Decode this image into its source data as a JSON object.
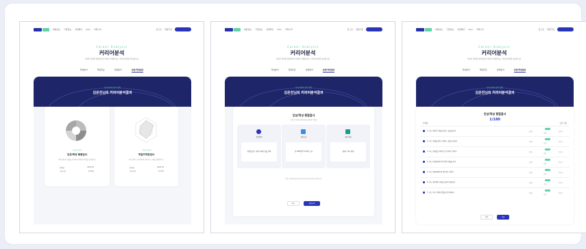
{
  "nav": {
    "menu": [
      "채용정보",
      "기업정보",
      "취업특강",
      "Q&A",
      "커뮤니티"
    ],
    "login_label": "로그인",
    "signup_label": "회원가입",
    "cta_label": "무료체험"
  },
  "hero": {
    "subtitle": "Career Analysis",
    "title": "커리어분석",
    "description": "적성과 역량을 정밀하게 분석하여 나에게 맞는 커리어 방향을 제시합니다"
  },
  "tabs": [
    "적성분석",
    "역량진단",
    "성향분석",
    "인성/적성검사"
  ],
  "banner": {
    "small_text": "나의 커리어 분석 결과",
    "title": "김은진님의 커리어분석결과"
  },
  "screen1": {
    "card1": {
      "title": "인성/적성 종합검사",
      "description": "나의 성향과 강점을 분석하여 적합한 직무를 추천합니다",
      "rows": [
        {
          "k": "검사일",
          "v": "2024.05"
        },
        {
          "k": "소요시간",
          "v": "약 20분"
        }
      ]
    },
    "card2": {
      "title": "직업가치관검사",
      "description": "직업 선택 시 중요하게 생각하는 가치를 확인합니다",
      "rows": [
        {
          "k": "검사일",
          "v": "2024.05"
        },
        {
          "k": "소요시간",
          "v": "약 15분"
        }
      ]
    }
  },
  "screen2": {
    "title": "인성/적성 종합검사",
    "description": "검사 전 아래 유의사항을 확인해 주세요",
    "items": [
      {
        "label": "검사방법",
        "detail": "문항을 읽고 가장 가까운 답을 선택",
        "color": "#2a35b8"
      },
      {
        "label": "검사시간",
        "detail": "총 180문항 약 20분 소요",
        "color": "#3c8de0"
      },
      {
        "label": "결과 확인",
        "detail": "결과는 즉시 확인",
        "color": "#1b9b8f"
      }
    ],
    "notice": "검사 중 페이지를 벗어나면 진행 내용이 저장되지 않습니다",
    "cancel_label": "취소",
    "start_label": "검사시작"
  },
  "screen3": {
    "title": "인성/적성 종합검사",
    "score": "1/180",
    "left_caption": "진행률",
    "right_caption": "남은 문항",
    "questions": [
      "1. 나는 새로운 사람을 만나는 것을 즐긴다",
      "2. 나는 계획을 세우고 일하는 것을 선호한다",
      "3. 나는 문제를 논리적으로 분석하는 편이다",
      "4. 나는 팀 활동에서 주도적인 역할을 한다",
      "5. 나는 변화에 빠르게 적응하는 편이다",
      "6. 나는 세부적인 사항을 꼼꼼히 확인한다",
      "7. 나는 다른 사람의 감정을 잘 이해한다"
    ],
    "answer_labels": [
      "그렇다",
      "보통",
      "아니다"
    ],
    "prev_label": "이전",
    "next_label": "다음"
  },
  "colors": {
    "brand": "#2a35b8",
    "accent": "#5fd3a6",
    "banner": "#1e2569"
  }
}
